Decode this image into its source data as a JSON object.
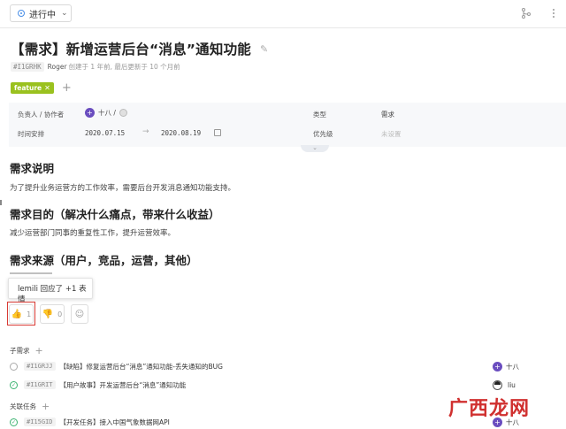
{
  "topbar": {
    "status_label": "进行中",
    "icons": [
      "flow-icon",
      "more-icon"
    ]
  },
  "title": "【需求】新增运营后台“消息”通知功能",
  "meta": {
    "id": "#I1GRHK",
    "author": "Roger",
    "info": "创建于 1 年前, 最后更新于 10 个月前"
  },
  "tags": [
    {
      "label": "feature"
    }
  ],
  "props": {
    "owner_label": "负责人 / 协作者",
    "owner_name": "十八 /",
    "type_label": "类型",
    "type_value": "需求",
    "schedule_label": "时间安排",
    "start_date": "2020.07.15",
    "end_date": "2020.08.19",
    "priority_label": "优先级",
    "priority_value": "未设置"
  },
  "content": {
    "h_desc": "需求说明",
    "p_desc": "为了提升业务运营方的工作效率，需要后台开发消息通知功能支持。",
    "h_goal": "需求目的（解决什么痛点，带来什么收益）",
    "p_goal": "减少运营部门同事的重复性工作，提升运营效率。",
    "h_source": "需求来源（用户，竞品，运营，其他）"
  },
  "tooltip": "lemili 回应了 +1 表情",
  "reactions": {
    "thumbs_up_count": "1",
    "thumbs_down_count": "0"
  },
  "subtasks": {
    "label": "子需求",
    "items": [
      {
        "id": "#I1GRJJ",
        "text": "【缺陷】修复运营后台“消息”通知功能-丢失通知的BUG",
        "assignee": "十八",
        "status": "open"
      },
      {
        "id": "#I1GRIT",
        "text": "【用户故事】开发运营后台“消息”通知功能",
        "assignee": "liu",
        "status": "done"
      }
    ]
  },
  "related": {
    "label": "关联任务",
    "items": [
      {
        "id": "#I15GID",
        "text": "【开发任务】接入中国气象数据网API",
        "assignee": "十八",
        "status": "done"
      }
    ]
  },
  "watermark": "广西龙网"
}
